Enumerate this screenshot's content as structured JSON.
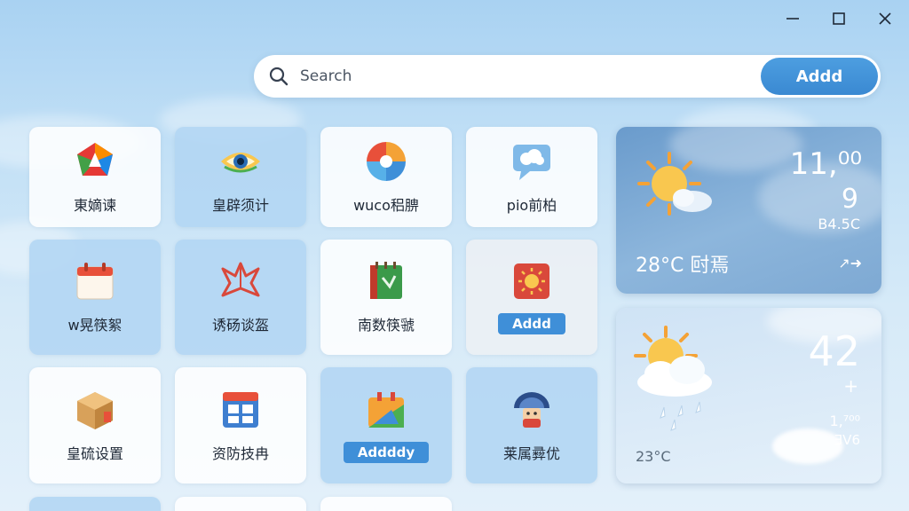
{
  "window": {
    "minimize_icon": "minimize-icon",
    "maximize_icon": "maximize-icon",
    "close_icon": "close-icon"
  },
  "search": {
    "placeholder": "Search",
    "button_label": "Addd"
  },
  "tiles": [
    {
      "label": "東嫡谏",
      "icon": "colorful-gem-icon"
    },
    {
      "label": "皇辟须计",
      "icon": "eye-icon"
    },
    {
      "label": "wuco稆腗",
      "icon": "pinwheel-icon"
    },
    {
      "label": "pio前柏",
      "icon": "chat-cloud-icon"
    },
    {
      "label": "w晃筷絮",
      "icon": "calendar-icon"
    },
    {
      "label": "诱砀谈盔",
      "icon": "star-origami-icon"
    },
    {
      "label": "南数筷虢",
      "icon": "notebook-icon"
    },
    {
      "label": "Addd",
      "icon": "sun-card-icon"
    },
    {
      "label": "皇硫设置",
      "icon": "package-icon"
    },
    {
      "label": "资防技冉",
      "icon": "grid-window-icon"
    },
    {
      "label": "Addddy",
      "icon": "gift-box-icon"
    },
    {
      "label": "莱属彛优",
      "icon": "umbrella-person-icon"
    }
  ],
  "weather_cards": [
    {
      "temp_main": "11,⁰⁰",
      "temp_secondary": "9",
      "detail": "B4.5C",
      "bottom_text": "28°C 尀焉",
      "arrow": "↗➜"
    },
    {
      "temp_main": "42",
      "plus": "+",
      "detail_a": "1,⁷⁰⁰",
      "detail_b": "ƎV6",
      "bottom_text": "23°C"
    }
  ],
  "colors": {
    "accent": "#3f8fd8",
    "tile_blue": "#b2d6f3",
    "background_top": "#a9d2f2"
  }
}
